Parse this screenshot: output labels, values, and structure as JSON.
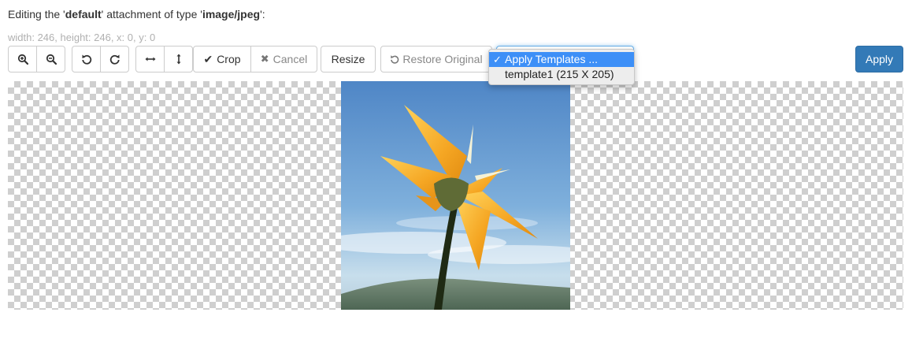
{
  "heading": {
    "prefix": "Editing the '",
    "attachment": "default",
    "middle": "' attachment of type '",
    "type": "image/jpeg",
    "suffix": "':"
  },
  "dimensions_text": "width: 246, height: 246, x: 0, y: 0",
  "toolbar": {
    "zoom_in_icon": "zoom-in-icon",
    "zoom_out_icon": "zoom-out-icon",
    "rotate_left_icon": "rotate-left-icon",
    "rotate_right_icon": "rotate-right-icon",
    "flip_horizontal_icon": "flip-horizontal-icon",
    "flip_vertical_icon": "flip-vertical-icon",
    "crop_label": "Crop",
    "cancel_label": "Cancel",
    "resize_label": "Resize",
    "restore_label": "Restore Original",
    "apply_label": "Apply"
  },
  "templates_dropdown": {
    "options": [
      {
        "label": "Apply Templates ...",
        "selected": true
      },
      {
        "label": "template1 (215 X 205)",
        "selected": false
      }
    ]
  },
  "colors": {
    "primary": "#337ab7",
    "dropdown_highlight": "#3d8ff7"
  }
}
